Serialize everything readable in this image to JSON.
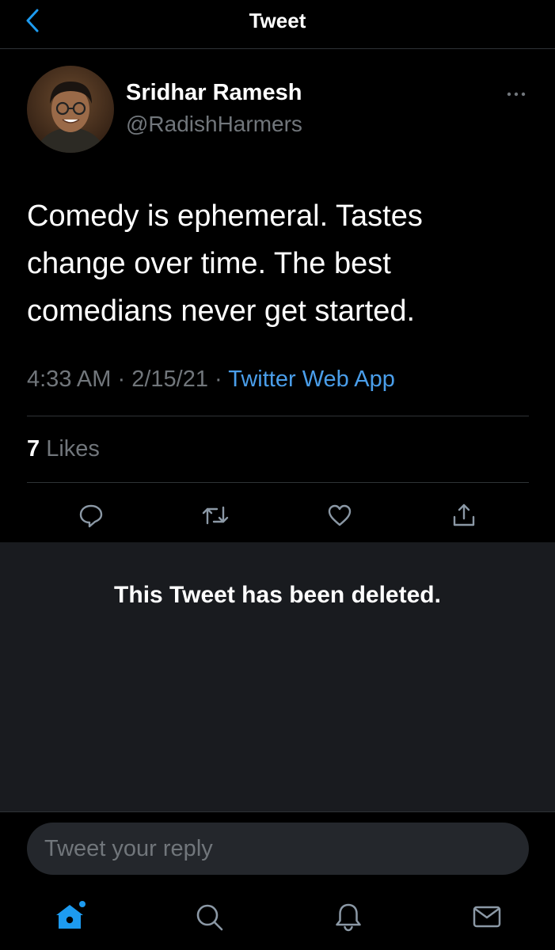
{
  "header": {
    "title": "Tweet",
    "back_icon": "chevron-left-icon"
  },
  "tweet": {
    "author_name": "Sridhar Ramesh",
    "author_handle": "@RadishHarmers",
    "text": "Comedy is ephemeral. Tastes change over time. The best comedians never get started.",
    "time": "4:33 AM",
    "separator": "·",
    "date": "2/15/21",
    "source": "Twitter Web App",
    "likes_count": "7",
    "likes_label": "Likes",
    "actions": [
      "reply-icon",
      "retweet-icon",
      "like-icon",
      "share-icon"
    ]
  },
  "quoted": {
    "deleted_message": "This Tweet has been deleted."
  },
  "reply": {
    "placeholder": "Tweet your reply"
  },
  "tabbar": {
    "tabs": [
      "home-icon",
      "search-icon",
      "notifications-icon",
      "messages-icon"
    ],
    "active": "home-icon"
  },
  "colors": {
    "accent": "#1d9bf0",
    "link": "#4a9eea",
    "muted": "#71767b",
    "panel": "#191b1f"
  }
}
